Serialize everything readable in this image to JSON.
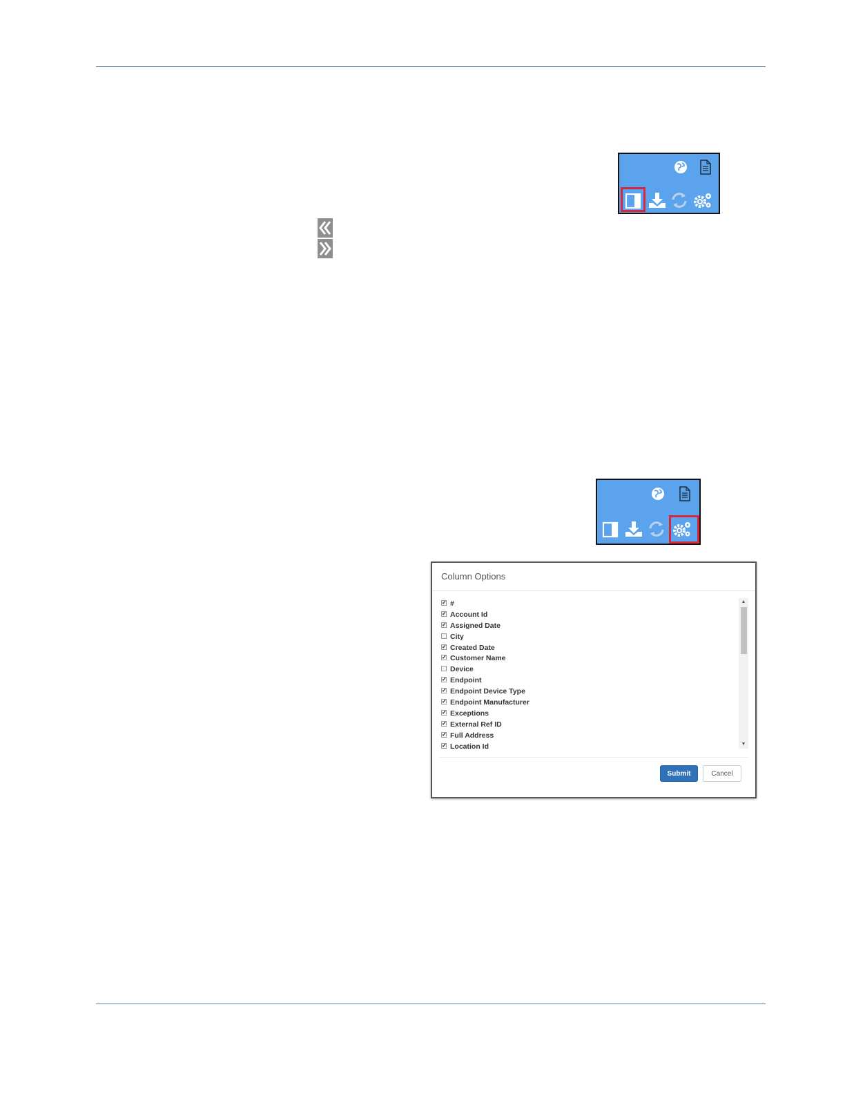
{
  "icons": {
    "globe": "globe-icon",
    "document": "document-icon",
    "panel_toggle": "panel-toggle-icon",
    "download": "download-icon",
    "refresh": "refresh-icon",
    "settings": "gears-icon",
    "collapse": "double-chevron-left-icon",
    "expand": "double-chevron-right-icon"
  },
  "colors": {
    "toolbar_bg": "#5ba3ec",
    "highlight": "#d6283b",
    "primary_button": "#2f72b8"
  },
  "column_options": {
    "title": "Column Options",
    "columns": [
      {
        "label": "#",
        "checked": true
      },
      {
        "label": "Account Id",
        "checked": true
      },
      {
        "label": "Assigned Date",
        "checked": true
      },
      {
        "label": "City",
        "checked": false
      },
      {
        "label": "Created Date",
        "checked": true
      },
      {
        "label": "Customer Name",
        "checked": true
      },
      {
        "label": "Device",
        "checked": false
      },
      {
        "label": "Endpoint",
        "checked": true
      },
      {
        "label": "Endpoint Device Type",
        "checked": true
      },
      {
        "label": "Endpoint Manufacturer",
        "checked": true
      },
      {
        "label": "Exceptions",
        "checked": true
      },
      {
        "label": "External Ref ID",
        "checked": true
      },
      {
        "label": "Full Address",
        "checked": true
      },
      {
        "label": "Location Id",
        "checked": true
      }
    ],
    "submit_label": "Submit",
    "cancel_label": "Cancel"
  }
}
